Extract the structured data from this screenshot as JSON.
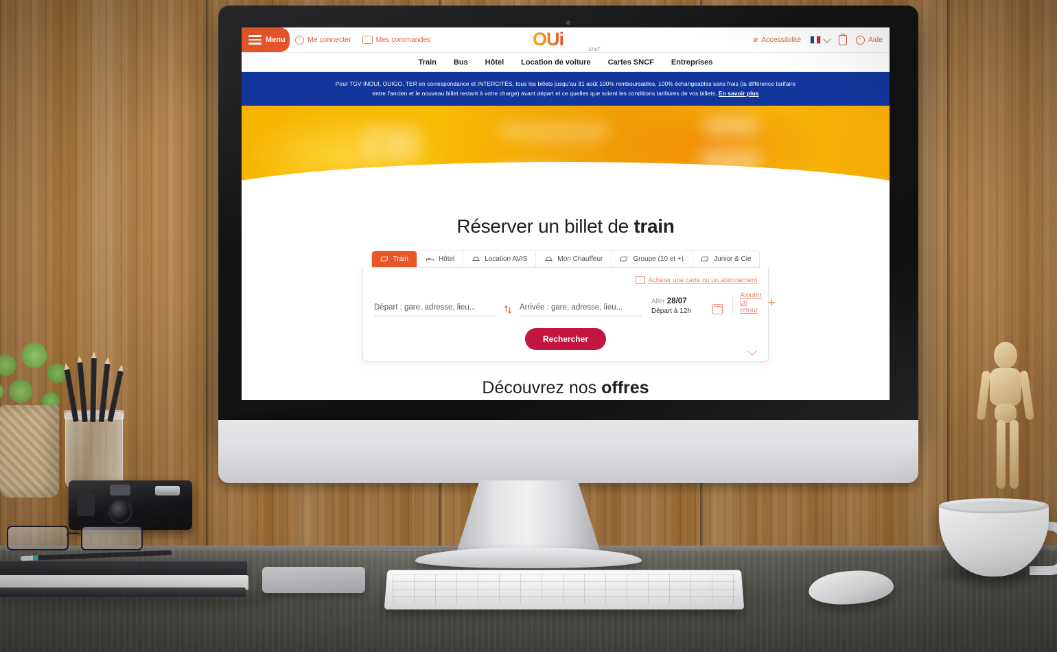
{
  "site": {
    "logo_text": "OUi",
    "logo_sub": ".sncf"
  },
  "topbar": {
    "menu_label": "Menu",
    "left_links": [
      {
        "label": "Me connecter",
        "icon": "account-circle-icon"
      },
      {
        "label": "Mes commandes",
        "icon": "ticket-icon"
      }
    ],
    "right_links": [
      {
        "label": "Accessibilité",
        "icon": "accessibility-icon"
      },
      {
        "label": "",
        "icon": "french-flag-icon"
      },
      {
        "label": "",
        "icon": "clipboard-icon"
      },
      {
        "label": "Aide",
        "icon": "help-icon"
      }
    ]
  },
  "nav": {
    "items": [
      "Train",
      "Bus",
      "Hôtel",
      "Location de voiture",
      "Cartes SNCF",
      "Entreprises"
    ]
  },
  "banner": {
    "line1": "Pour TGV INOUI, OUIGO, TER en correspondance et INTERCITÉS, tous les billets jusqu'au 31 août 100% remboursables, 100% échangeables sans frais (la différence tarifaire",
    "line2": "entre l'ancien et le nouveau billet restant à votre charge) avant départ et ce quelles que soient les conditions tarifaires de vos billets.",
    "link": "En savoir plus",
    "bg_color": "#12369b"
  },
  "headings": {
    "title_light": "Réserver un billet de ",
    "title_bold": "train",
    "offers_light": "Découvrez nos ",
    "offers_bold": "offres"
  },
  "tabs": [
    {
      "label": "Train",
      "icon": "train-icon",
      "active": true
    },
    {
      "label": "Hôtel",
      "icon": "bed-icon",
      "active": false
    },
    {
      "label": "Location AVIS",
      "icon": "car-icon",
      "active": false
    },
    {
      "label": "Mon Chauffeur",
      "icon": "car-icon",
      "active": false
    },
    {
      "label": "Groupe (10 et +)",
      "icon": "train-icon",
      "active": false
    },
    {
      "label": "Junior & Cie",
      "icon": "train-icon",
      "active": false
    }
  ],
  "search_form": {
    "buy_card_link": "Acheter une carte ou un abonnement",
    "departure_placeholder": "Départ : gare, adresse, lieu...",
    "arrival_placeholder": "Arrivée : gare, adresse, lieu...",
    "swap_icon": "swap-arrows-icon",
    "date_label": "Aller",
    "date_value": "28/07",
    "time_label": "Départ à 12h",
    "calendar_icon": "calendar-icon",
    "add_return_label": "Ajouter un retour",
    "search_button": "Rechercher",
    "expand_icon": "chevron-down-icon"
  },
  "colors": {
    "orange": "#e8572a",
    "crimson": "#c2153f",
    "blue": "#12369b",
    "yellow": "#f7b500",
    "link": "#e8836a"
  }
}
